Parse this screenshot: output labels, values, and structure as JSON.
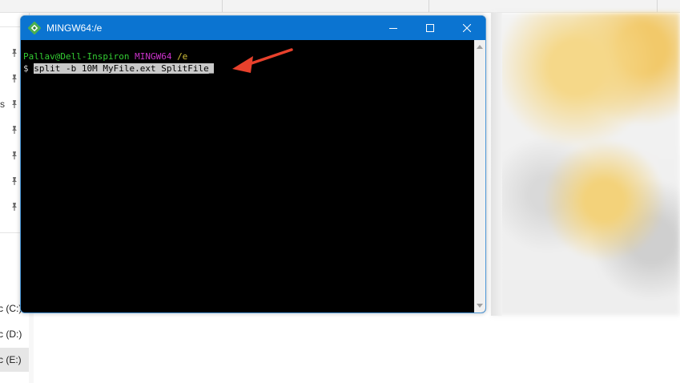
{
  "terminal": {
    "title": "MINGW64:/e",
    "prompt": {
      "user_host": "Pallav@Dell-Inspiron",
      "env": "MINGW64",
      "path": "/e"
    },
    "dollar": "$",
    "command": "split -b 10M MyFile.ext SplitFile_"
  },
  "sidebar": {
    "fragments": [
      "s"
    ],
    "drives": [
      {
        "label": "c (C:)",
        "selected": false
      },
      {
        "label": "c (D:)",
        "selected": false
      },
      {
        "label": "c (E:)",
        "selected": true
      }
    ]
  },
  "colors": {
    "titlebar": "#0b74d1",
    "prompt_user": "#33cc33",
    "prompt_env": "#cc33cc",
    "prompt_path": "#d4c23a",
    "selection": "#c9c9c9",
    "annotation_arrow": "#e8412c"
  },
  "icons": {
    "app": "mingw-icon",
    "minimize": "minimize-icon",
    "maximize": "maximize-icon",
    "close": "close-icon",
    "pin": "pin-icon",
    "annotation": "red-arrow-icon"
  }
}
